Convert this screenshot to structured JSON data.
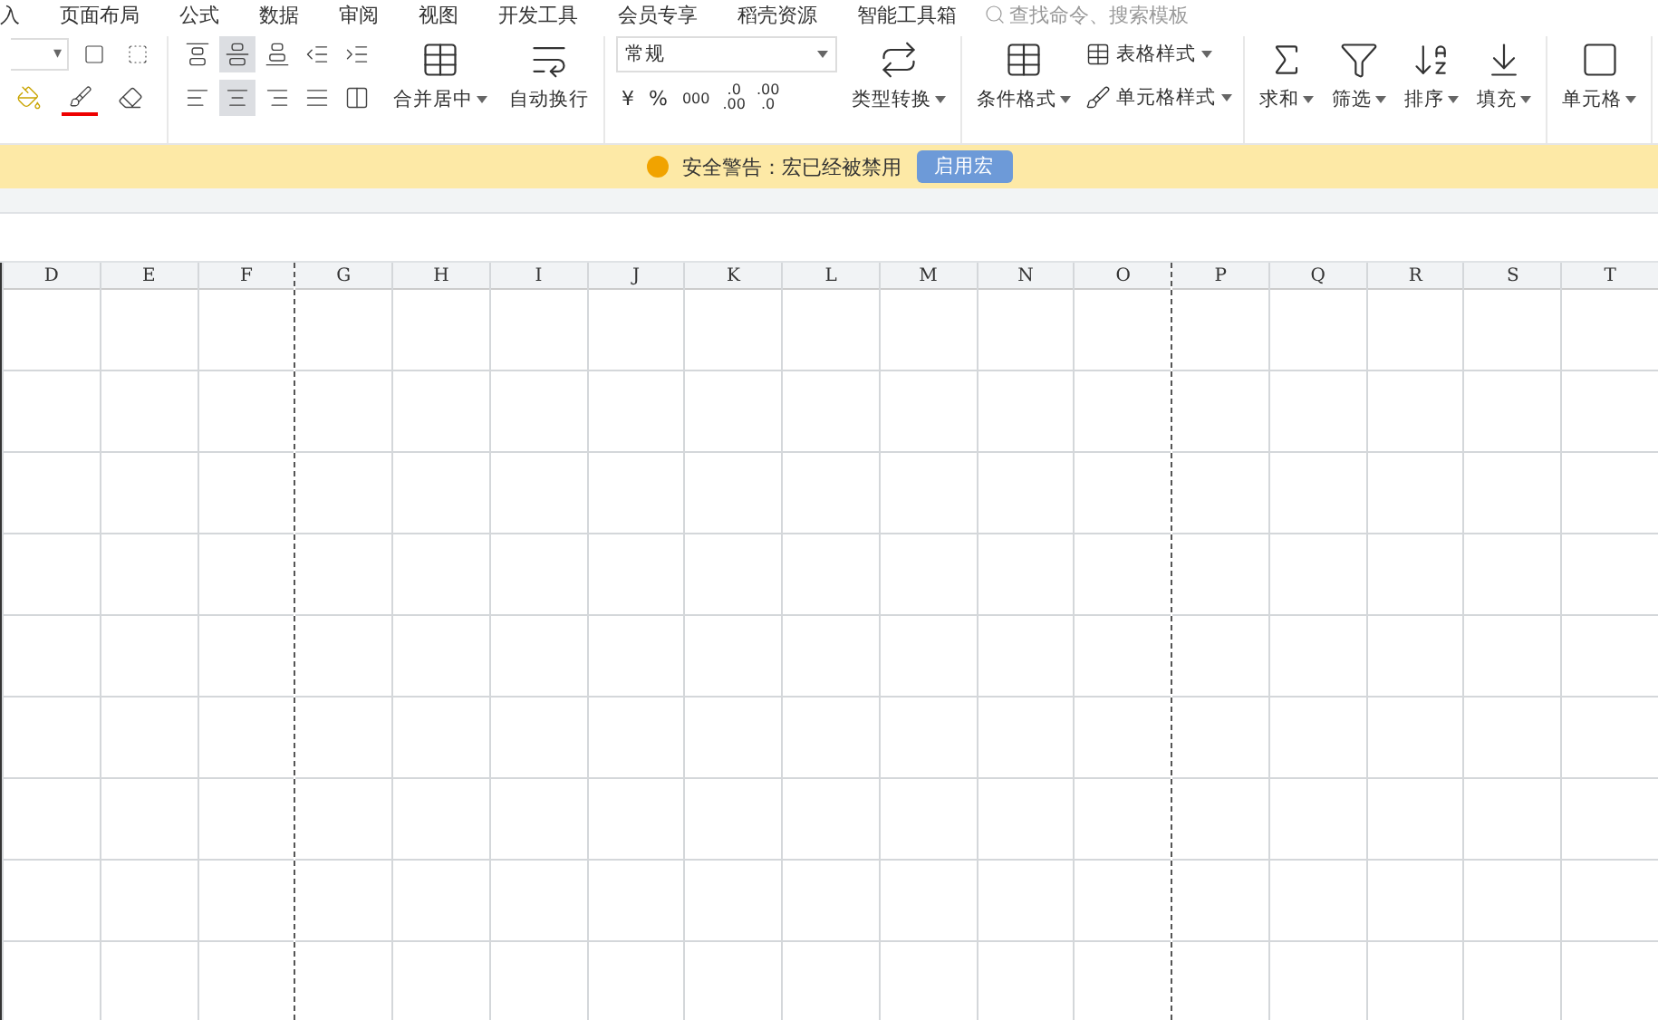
{
  "menu": {
    "items": [
      "入",
      "页面布局",
      "公式",
      "数据",
      "审阅",
      "视图",
      "开发工具",
      "会员专享",
      "稻壳资源",
      "智能工具箱"
    ],
    "search": {
      "placeholder": "查找命令、搜索模板"
    }
  },
  "font_group": {
    "size_dropdown": "▾"
  },
  "align_group": {
    "buttons": [
      {
        "kind": "top",
        "selected": false
      },
      {
        "kind": "middle",
        "selected": true
      },
      {
        "kind": "bottom",
        "selected": false
      },
      {
        "kind": "outdent",
        "selected": false
      },
      {
        "kind": "indent",
        "selected": false
      },
      {
        "kind": "left",
        "selected": false
      },
      {
        "kind": "center",
        "selected": true
      },
      {
        "kind": "right",
        "selected": false
      },
      {
        "kind": "justify",
        "selected": false
      },
      {
        "kind": "distribute",
        "selected": false
      }
    ],
    "merge": "合并居中",
    "wrap": "自动换行"
  },
  "number_group": {
    "format": "常规",
    "currency": "¥",
    "percent": "%",
    "thousands": "000",
    "add_decimal": [
      ".0",
      ".00"
    ],
    "remove_decimal": [
      ".00",
      ".0"
    ],
    "convert": "类型转换"
  },
  "style_group": {
    "conditional": "条件格式",
    "table_style": "表格样式",
    "cell_style": "单元格样式"
  },
  "edit_group": {
    "sum": "求和",
    "filter": "筛选",
    "sort": "排序",
    "fill": "填充",
    "cell": "单元格"
  },
  "warning_bar": {
    "message": "安全警告：宏已经被禁用",
    "button": "启用宏"
  },
  "columns": [
    {
      "label": "D",
      "page_break": false
    },
    {
      "label": "E",
      "page_break": false
    },
    {
      "label": "F",
      "page_break": false
    },
    {
      "label": "G",
      "page_break": true
    },
    {
      "label": "H",
      "page_break": false
    },
    {
      "label": "I",
      "page_break": false
    },
    {
      "label": "J",
      "page_break": false
    },
    {
      "label": "K",
      "page_break": false
    },
    {
      "label": "L",
      "page_break": false
    },
    {
      "label": "M",
      "page_break": false
    },
    {
      "label": "N",
      "page_break": false
    },
    {
      "label": "O",
      "page_break": false
    },
    {
      "label": "P",
      "page_break": true
    },
    {
      "label": "Q",
      "page_break": false
    },
    {
      "label": "R",
      "page_break": false
    },
    {
      "label": "S",
      "page_break": false
    },
    {
      "label": "T",
      "page_break": false
    }
  ]
}
